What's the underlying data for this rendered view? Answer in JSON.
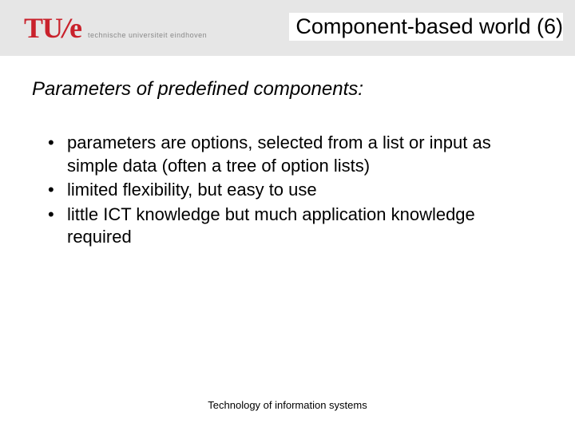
{
  "logo": {
    "mark_prefix": "TU",
    "mark_slash": "/",
    "mark_suffix": "e",
    "text": "technische universiteit eindhoven"
  },
  "title": "Component-based world (6)",
  "subtitle": "Parameters of predefined components:",
  "bullets": [
    "parameters are options, selected from a list or input as simple data (often a tree of option lists)",
    "limited flexibility, but easy to use",
    "little ICT knowledge but much application knowledge required"
  ],
  "footer": "Technology of  information systems"
}
